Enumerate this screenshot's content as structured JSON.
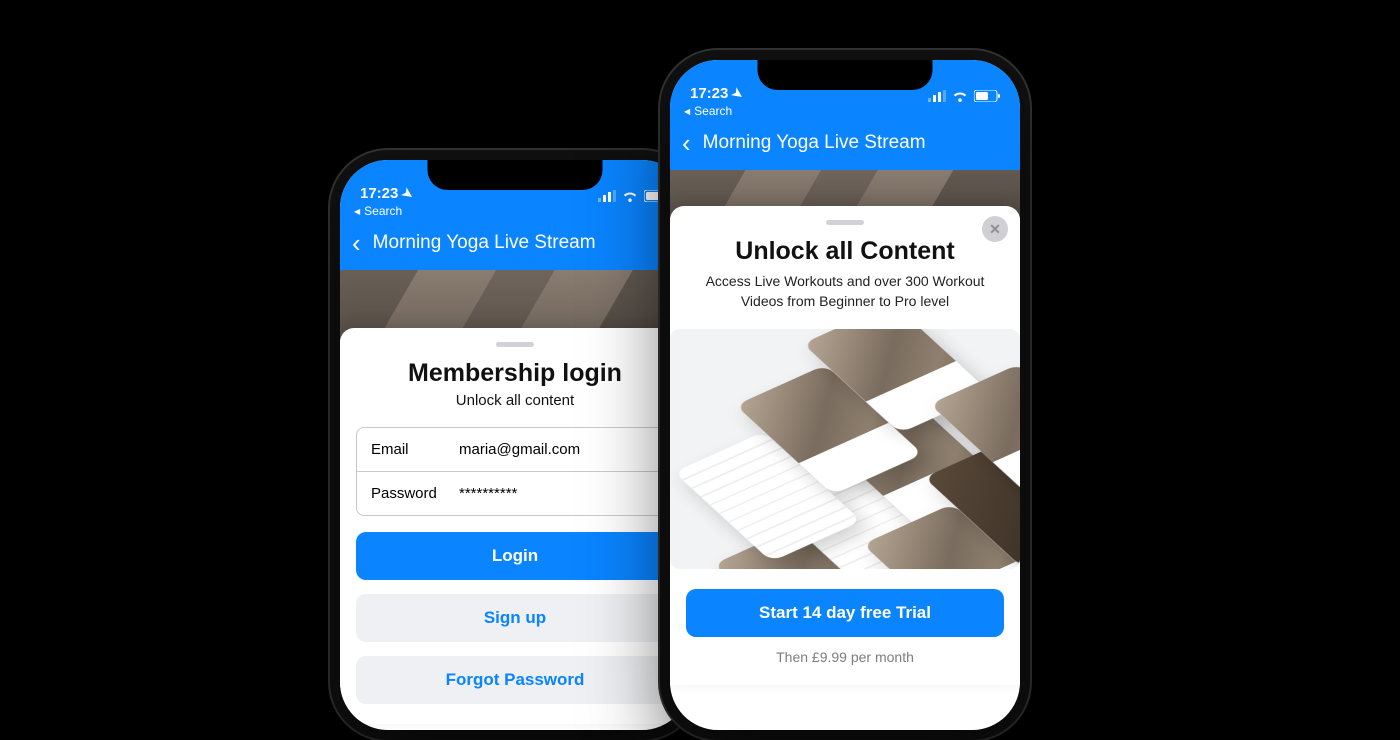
{
  "status": {
    "time": "17:23",
    "back_label": "Search"
  },
  "nav": {
    "title": "Morning Yoga Live Stream"
  },
  "login": {
    "title": "Membership login",
    "subtitle": "Unlock all content",
    "email_label": "Email",
    "email_value": "maria@gmail.com",
    "password_label": "Password",
    "password_value": "**********",
    "login_btn": "Login",
    "signup_btn": "Sign up",
    "forgot_btn": "Forgot Password"
  },
  "paywall": {
    "title": "Unlock all Content",
    "subtitle": "Access Live Workouts and over 300 Workout Videos from Beginner to Pro level",
    "cta": "Start 14 day free Trial",
    "price": "Then £9.99 per month"
  }
}
